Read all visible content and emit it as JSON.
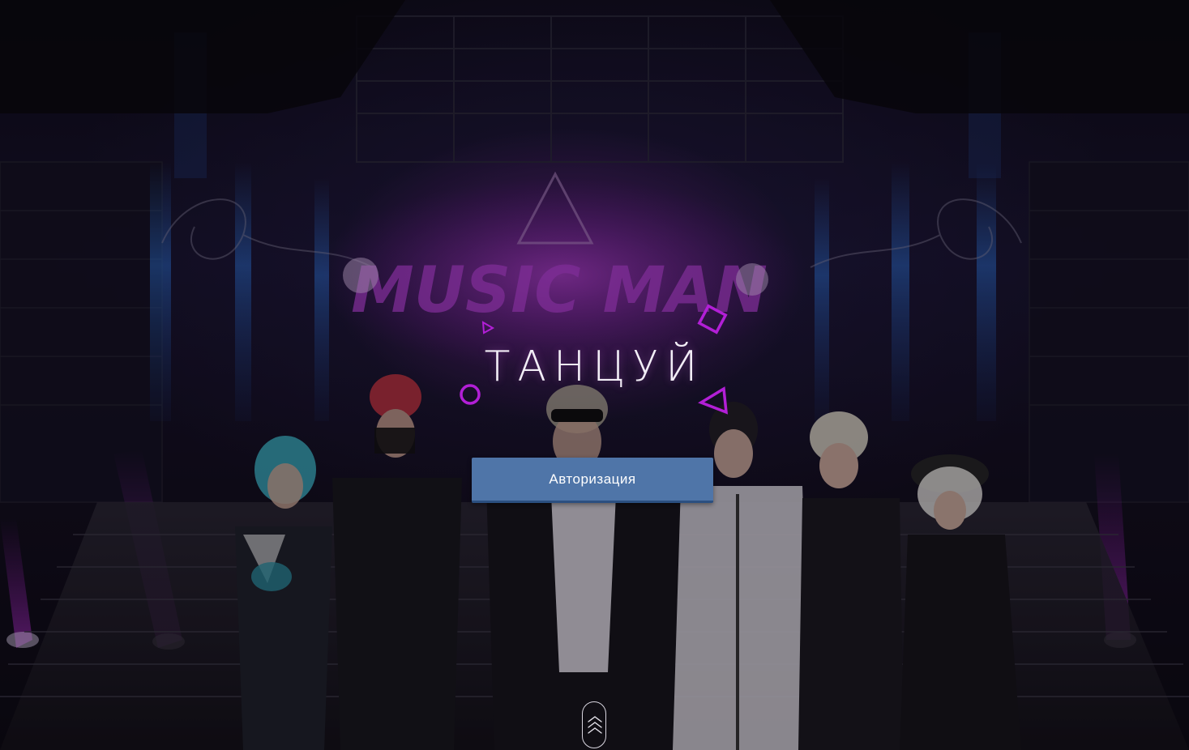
{
  "hero": {
    "title": "ТАНЦУЙ",
    "logo_text": "MUSIC MAN"
  },
  "auth": {
    "button_label": "Авторизация"
  },
  "icons": {
    "scroll": "chevrons-up-icon"
  },
  "colors": {
    "button": "#4f75a8",
    "accent": "#b523d6",
    "title": "#f2eef6"
  }
}
